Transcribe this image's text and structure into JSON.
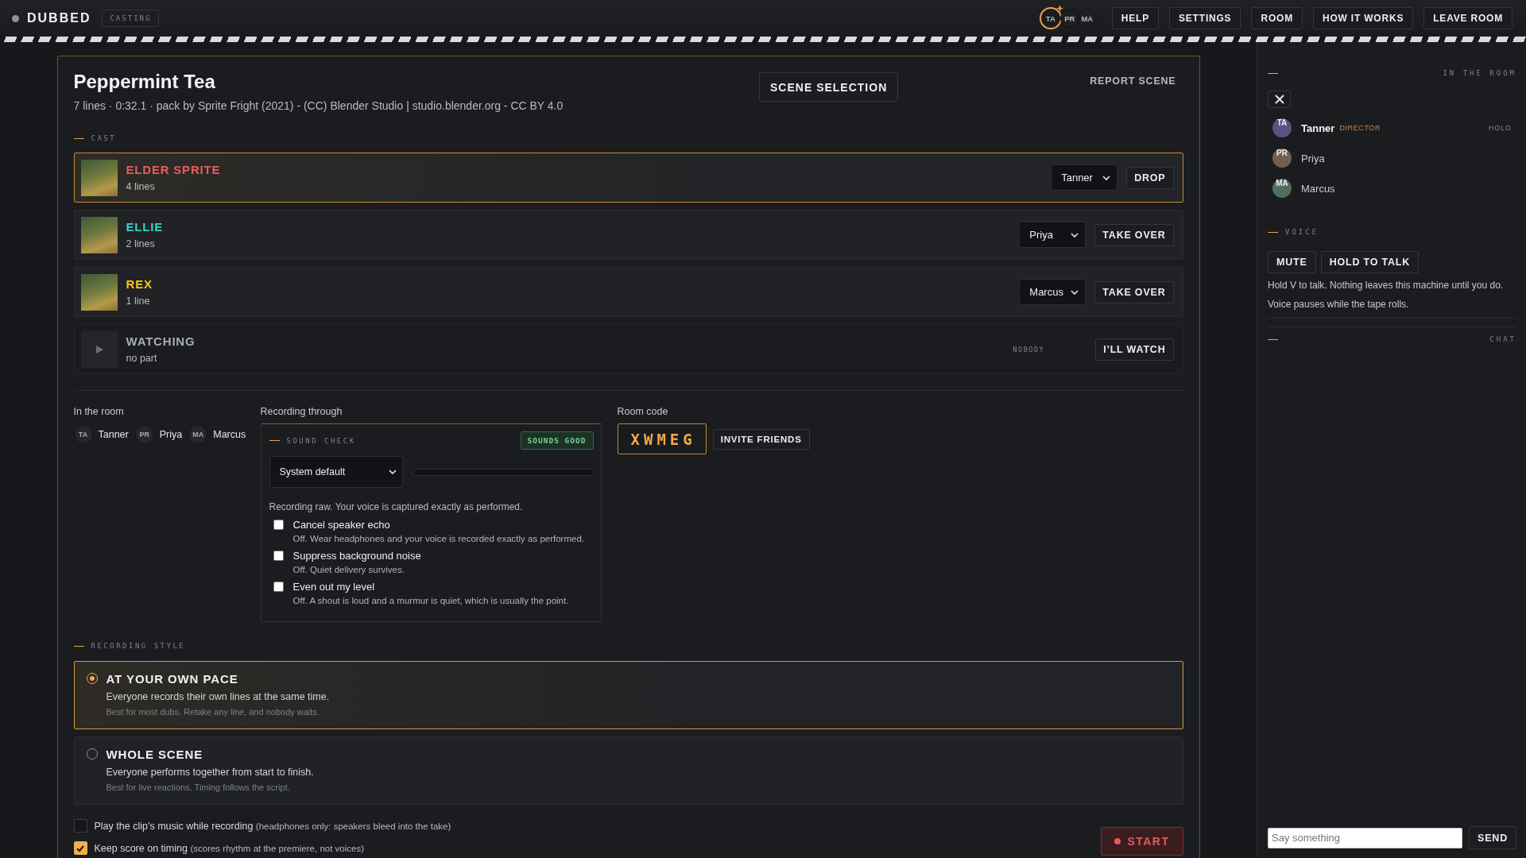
{
  "topbar": {
    "logo": "DUBBED",
    "badge": "CASTING",
    "avatars": [
      {
        "initials": "TA",
        "current": true
      },
      {
        "initials": "PR",
        "current": false
      },
      {
        "initials": "MA",
        "current": false
      }
    ],
    "buttons": [
      "HELP",
      "SETTINGS",
      "ROOM",
      "HOW IT WORKS",
      "LEAVE ROOM"
    ]
  },
  "scene": {
    "title": "Peppermint Tea",
    "meta": "7 lines · 0:32.1 · pack by Sprite Fright (2021) - (CC) Blender Studio | studio.blender.org - CC BY 4.0",
    "scene_selection_button": "SCENE SELECTION",
    "report_button": "REPORT SCENE"
  },
  "cast": {
    "heading": "CAST",
    "rows": [
      {
        "kind": "role",
        "name": "ELDER SPRITE",
        "color": "#e85d5d",
        "lines": "4 lines",
        "assignee": "Tanner",
        "action": "DROP",
        "selected": true
      },
      {
        "kind": "role",
        "name": "ELLIE",
        "color": "#3ccfc4",
        "lines": "2 lines",
        "assignee": "Priya",
        "action": "TAKE OVER",
        "selected": false
      },
      {
        "kind": "role",
        "name": "REX",
        "color": "#f2c521",
        "lines": "1 line",
        "assignee": "Marcus",
        "action": "TAKE OVER",
        "selected": false
      },
      {
        "kind": "watch",
        "name": "WATCHING",
        "lines": "no part",
        "status": "NOBODY",
        "action": "I’LL WATCH",
        "selected": false
      }
    ]
  },
  "in_the_room": {
    "heading": "In the room",
    "members": [
      {
        "initials": "TA",
        "name": "Tanner"
      },
      {
        "initials": "PR",
        "name": "Priya"
      },
      {
        "initials": "MA",
        "name": "Marcus"
      }
    ]
  },
  "recording_through": {
    "heading": "Recording through",
    "sound_check": {
      "title": "SOUND CHECK",
      "status": "SOUNDS GOOD",
      "device": "System default",
      "note": "Recording raw. Your voice is captured exactly as performed.",
      "options": [
        {
          "label": "Cancel speaker echo",
          "detail": "Off. Wear headphones and your voice is recorded exactly as performed.",
          "checked": false
        },
        {
          "label": "Suppress background noise",
          "detail": "Off. Quiet delivery survives.",
          "checked": false
        },
        {
          "label": "Even out my level",
          "detail": "Off. A shout is loud and a murmur is quiet, which is usually the point.",
          "checked": false
        }
      ]
    }
  },
  "room_code": {
    "heading": "Room code",
    "code": "XWMEG",
    "invite_button": "INVITE FRIENDS"
  },
  "recording_style": {
    "heading": "RECORDING STYLE",
    "options": [
      {
        "title": "AT YOUR OWN PACE",
        "description": "Everyone records their own lines at the same time.",
        "hint": "Best for most dubs. Retake any line, and nobody waits.",
        "selected": true
      },
      {
        "title": "WHOLE SCENE",
        "description": "Everyone performs together from start to finish.",
        "hint": "Best for live reactions. Timing follows the script.",
        "selected": false
      }
    ]
  },
  "toggles": [
    {
      "label": "Play the clip’s music while recording",
      "note": "(headphones only: speakers bleed into the take)",
      "checked": false
    },
    {
      "label": "Keep score on timing",
      "note": "(scores rhythm at the premiere, not voices)",
      "checked": true
    }
  ],
  "start_button": "START",
  "sidebar": {
    "room": {
      "heading": "IN THE ROOM",
      "members": [
        {
          "initials": "TA",
          "name": "Tanner",
          "role": "DIRECTOR",
          "status": "HOLD",
          "color": "#5e5080",
          "current": true
        },
        {
          "initials": "PR",
          "name": "Priya",
          "color": "#72604f",
          "current": false
        },
        {
          "initials": "MA",
          "name": "Marcus",
          "color": "#4f6e5b",
          "current": false
        }
      ]
    },
    "voice": {
      "heading": "VOICE",
      "buttons": [
        "MUTE",
        "HOLD TO TALK"
      ],
      "notes": [
        "Hold V to talk. Nothing leaves this machine until you do.",
        "Voice pauses while the tape rolls."
      ]
    },
    "chat": {
      "heading": "CHAT",
      "input": {
        "placeholder": "Say something"
      },
      "send_button": "SEND"
    }
  }
}
